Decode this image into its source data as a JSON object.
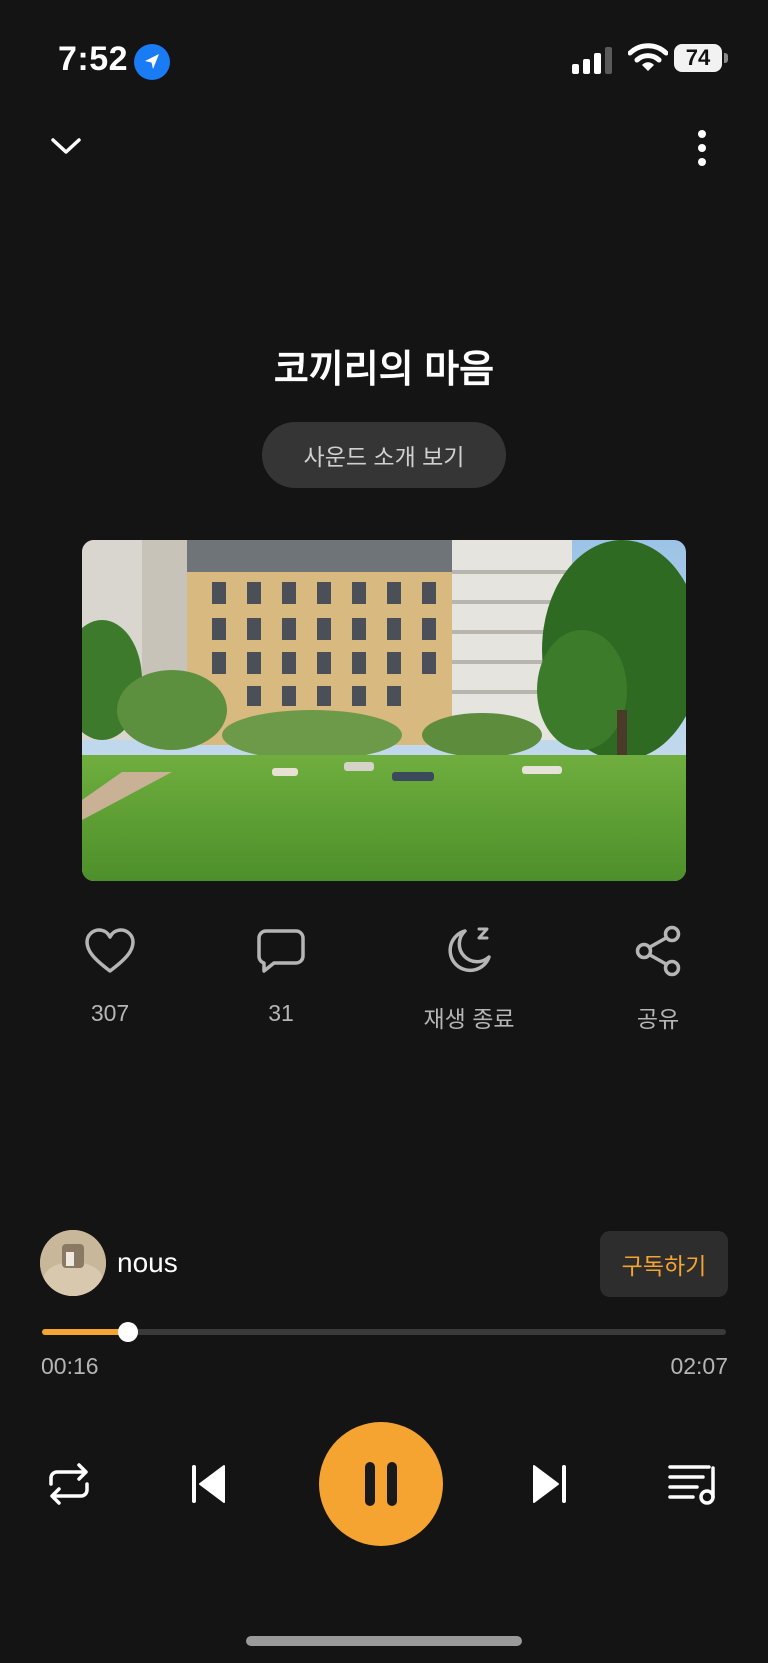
{
  "status_bar": {
    "time": "7:52",
    "battery": "74",
    "icons": [
      "location-arrow-icon",
      "signal-icon",
      "wifi-icon",
      "battery-icon"
    ]
  },
  "nav": {
    "collapse_icon": "chevron-down-icon",
    "more_icon": "more-vertical-icon"
  },
  "player": {
    "title": "코끼리의 마음",
    "intro_button": "사운드 소개 보기",
    "cover_description_icon": "park-photo"
  },
  "actions": [
    {
      "icon": "heart-icon",
      "label": "307"
    },
    {
      "icon": "comment-icon",
      "label": "31"
    },
    {
      "icon": "sleep-timer-icon",
      "label": "재생 종료"
    },
    {
      "icon": "share-icon",
      "label": "공유"
    }
  ],
  "channel": {
    "name": "nous",
    "subscribe_label": "구독하기"
  },
  "progress": {
    "current": "00:16",
    "total": "02:07",
    "fraction": 0.126
  },
  "controls": {
    "icons": [
      "repeat-icon",
      "previous-icon",
      "pause-icon",
      "next-icon",
      "playlist-icon"
    ]
  },
  "colors": {
    "background": "#141414",
    "accent": "#f5a331",
    "muted_text": "#b5b5b5"
  }
}
